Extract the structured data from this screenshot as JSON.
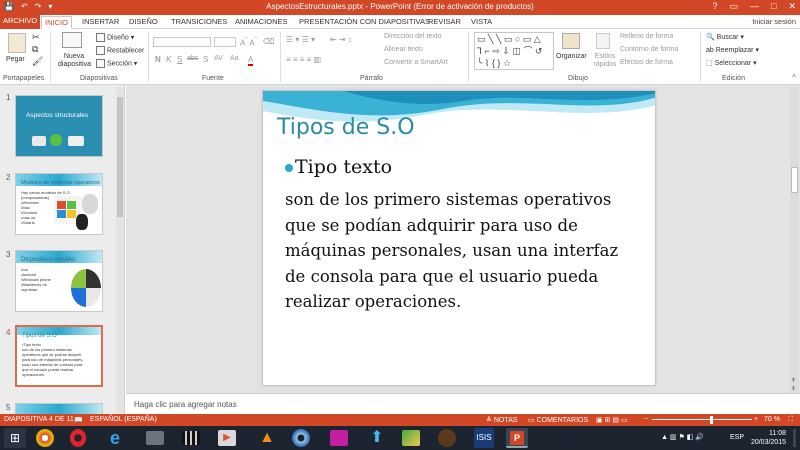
{
  "titlebar": {
    "title": "AspectosEstructurales.pptx - PowerPoint (Error de activación de productos)",
    "quick_access": [
      "💾",
      "↶",
      "↷",
      "▾"
    ],
    "controls": [
      "?",
      "▭",
      "—",
      "□",
      "✕"
    ]
  },
  "tabs": {
    "items": [
      "ARCHIVO",
      "INICIO",
      "INSERTAR",
      "DISEÑO",
      "TRANSICIONES",
      "ANIMACIONES",
      "PRESENTACIÓN CON DIAPOSITIVAS",
      "REVISAR",
      "VISTA"
    ],
    "active": "INICIO",
    "signin": "Iniciar sesión"
  },
  "ribbon": {
    "groups": {
      "clipboard": "Portapapeles",
      "slides": "Diapositivas",
      "font": "Fuente",
      "paragraph": "Párrafo",
      "drawing": "Dibujo",
      "editing": "Edición"
    },
    "paste": "Pegar",
    "new_slide": "Nueva diapositiva",
    "layout": "Diseño",
    "reset": "Restablecer",
    "section": "Sección",
    "text_direction": "Dirección del texto",
    "align_text": "Alinear texto",
    "smartart": "Convertir a SmartArt",
    "arrange": "Organizar",
    "quick_styles": "Estilos rápidos",
    "shape_fill": "Relleno de forma",
    "shape_outline": "Contorno de forma",
    "shape_effects": "Efectos de forma",
    "find": "Buscar",
    "replace": "Reemplazar",
    "select": "Seleccionar",
    "font_buttons": [
      "N",
      "K",
      "S",
      "abc",
      "S",
      "AV",
      "Aa",
      "A"
    ]
  },
  "thumbnails": [
    {
      "num": "1",
      "title": "Aspectos structurales",
      "text": ""
    },
    {
      "num": "2",
      "title": "Modelos de sistemas operativos",
      "text": "Hay varios modelos de S.O\n(computadoras)\n•Windows\n•Mac\n•Dominio\n•mac os\n•Solaris"
    },
    {
      "num": "3",
      "title": "Dispositivos moviles",
      "text": "•Ios\n•Android\n•Windows phone\n•Blackberry os\n•symbian"
    },
    {
      "num": "4",
      "title": "Tipos de S.O",
      "text": "•Tipo texto\nson de los primero sistemas\noperativos que se podían adquirir\npara uso de máquinas personales,\nusan una interfaz de consola para\nque el usuario pueda realizar\noperaciones."
    },
    {
      "num": "5",
      "title": "",
      "text": ""
    }
  ],
  "slide": {
    "title": "Tipos de S.O",
    "bullet": "Tipo texto",
    "body": "son de los primero sistemas operativos que se podían adquirir para uso de máquinas personales, usan una interfaz de consola para que el usuario pueda realizar operaciones."
  },
  "notes_placeholder": "Haga clic para agregar notas",
  "status": {
    "slide_counter": "DIAPOSITIVA 4 DE 11",
    "language": "ESPAÑOL (ESPAÑA)",
    "notes": "NOTAS",
    "comments": "COMENTARIOS",
    "zoom": "70 %"
  },
  "taskbar": {
    "lang": "ESP",
    "time": "11:08",
    "date": "20/03/2015"
  },
  "colors": {
    "accent": "#d24726",
    "title_teal": "#2a8aa5"
  }
}
